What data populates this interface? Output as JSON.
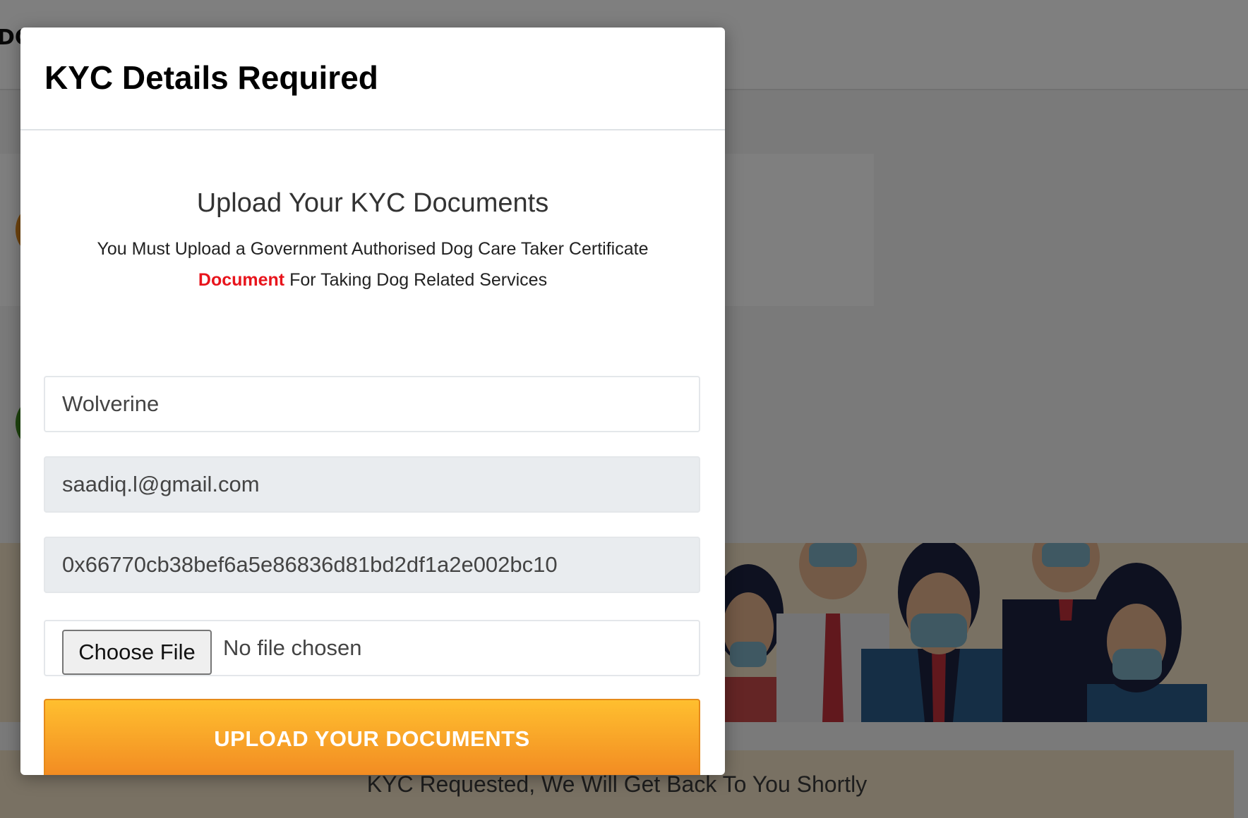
{
  "background": {
    "brand_text": "DG",
    "status_message": "KYC Requested, We Will Get Back To You Shortly"
  },
  "modal": {
    "title": "KYC Details Required",
    "heading": "Upload Your KYC Documents",
    "description": {
      "line1": "You Must Upload a Government Authorised Dog Care Taker Certificate",
      "highlight": "Document",
      "line2": " For Taking Dog Related Services"
    },
    "form": {
      "name_value": "Wolverine",
      "email_value": "saadiq.l@gmail.com",
      "wallet_value": "0x66770cb38bef6a5e86836d81bd2df1a2e002bc10",
      "file_button_label": "Choose File",
      "file_status": "No file chosen",
      "submit_label": "UPLOAD YOUR DOCUMENTS"
    }
  },
  "colors": {
    "highlight": "#e8141c",
    "button_gradient_top": "#ffbf2f",
    "button_gradient_bottom": "#f28a22",
    "backdrop": "rgba(0,0,0,0.5)"
  }
}
